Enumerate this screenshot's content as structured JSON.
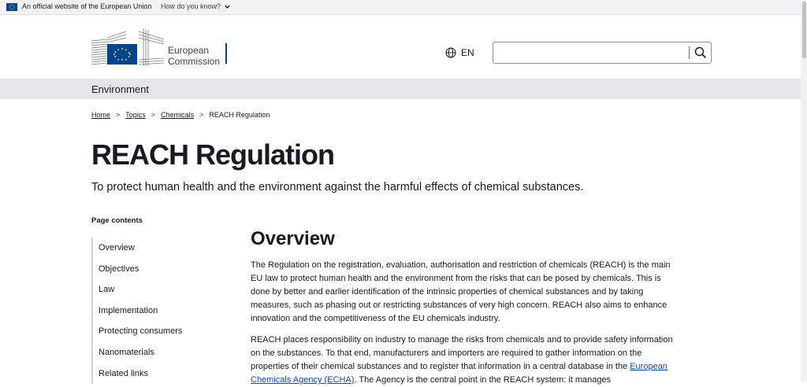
{
  "topbar": {
    "official_text": "An official website of the European Union",
    "how_text": "How do you know?"
  },
  "header": {
    "logo_line1": "European",
    "logo_line2": "Commission",
    "lang": "EN",
    "search_placeholder": ""
  },
  "site_name": "Environment",
  "breadcrumb": [
    "Home",
    "Topics",
    "Chemicals",
    "REACH Regulation"
  ],
  "page": {
    "title": "REACH Regulation",
    "subtitle": "To protect human health and the environment against the harmful effects of chemical substances."
  },
  "page_contents": {
    "title": "Page contents",
    "items": [
      "Overview",
      "Objectives",
      "Law",
      "Implementation",
      "Protecting consumers",
      "Nanomaterials",
      "Related links"
    ]
  },
  "main": {
    "heading": "Overview",
    "p1": "The Regulation on the registration, evaluation, authorisation and restriction of chemicals (REACH) is the main EU law to protect human health and the environment from the risks that can be posed by chemicals. This is done by better and earlier identification of the intrinsic properties of chemical substances and by taking measures, such as phasing out or restricting substances of very high concern. REACH also aims to enhance innovation and the competitiveness of the EU chemicals industry.",
    "p2_before": "REACH places responsibility on industry to manage the risks from chemicals and to provide safety information on the substances. To that end, manufacturers and importers are required to gather information on the properties of their chemical substances and to register that information in a central database in the ",
    "p2_link": "European Chemicals Agency (ECHA)",
    "p2_after": ". The Agency is the central point in the REACH system: it manages"
  },
  "colors": {
    "eu_blue": "#004494",
    "link_blue": "#0e47cb",
    "site_bar": "#e5e6ea"
  }
}
